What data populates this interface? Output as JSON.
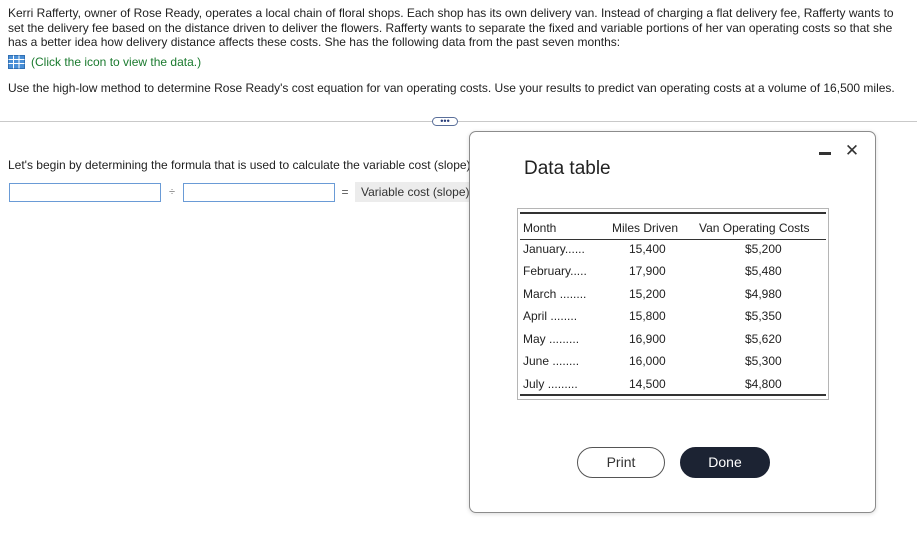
{
  "problem": {
    "text": "Kerri Rafferty, owner of Rose Ready, operates a local chain of floral shops. Each shop has its own delivery van. Instead of charging a flat delivery fee, Rafferty wants to set the delivery fee based on the distance driven to deliver the flowers. Rafferty wants to separate the fixed and variable portions of her van operating costs so that she has a better idea how delivery distance affects these costs. She has the following data from the past seven months:",
    "data_link": "(Click the icon to view the data.)",
    "instruction": "Use the high-low method to determine Rose Ready's cost equation for van operating costs. Use your results to predict van operating costs at a volume of 16,500 miles."
  },
  "more_button": "•••",
  "step": {
    "text": "Let's begin by determining the formula that is used to calculate the variable cost (slope).",
    "input1_value": "",
    "operator": "÷",
    "input2_value": "",
    "equals": "=",
    "result_label": "Variable cost (slope)"
  },
  "modal": {
    "title": "Data table",
    "minimize": "minimize",
    "close": "✕",
    "columns": [
      "Month",
      "Miles Driven",
      "Van Operating Costs"
    ],
    "rows": [
      {
        "month": "January",
        "dots": "......",
        "miles": "15,400",
        "cost": "$5,200"
      },
      {
        "month": "February",
        "dots": ".....",
        "miles": "17,900",
        "cost": "$5,480"
      },
      {
        "month": "March",
        "dots": "........",
        "miles": "15,200",
        "cost": "$4,980"
      },
      {
        "month": "April",
        "dots": "........",
        "miles": "15,800",
        "cost": "$5,350"
      },
      {
        "month": "May",
        "dots": ".........",
        "miles": "16,900",
        "cost": "$5,620"
      },
      {
        "month": "June",
        "dots": "........",
        "miles": "16,000",
        "cost": "$5,300"
      },
      {
        "month": "July",
        "dots": ".........",
        "miles": "14,500",
        "cost": "$4,800"
      }
    ],
    "print_label": "Print",
    "done_label": "Done"
  },
  "colors": {
    "link_green": "#1a7a2e",
    "input_border": "#6a9bd6",
    "done_bg": "#1c2333"
  }
}
